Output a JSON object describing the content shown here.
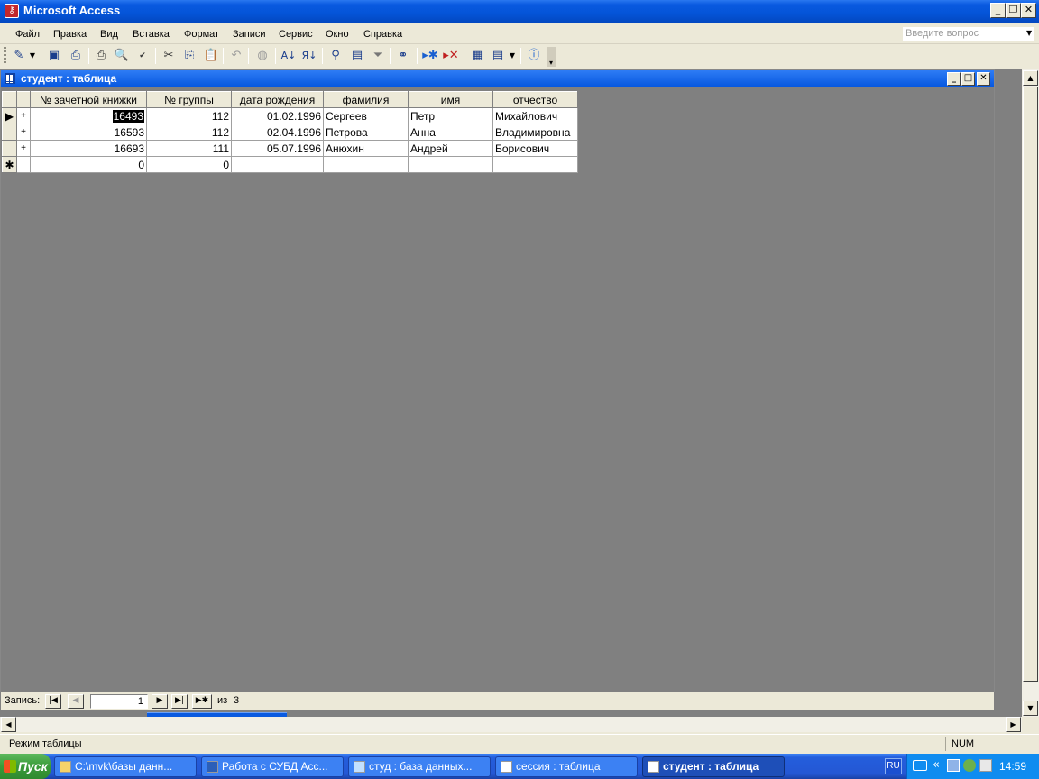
{
  "app": {
    "title": "Microsoft Access",
    "icon": "access-key-icon"
  },
  "menu": {
    "items": [
      "Файл",
      "Правка",
      "Вид",
      "Вставка",
      "Формат",
      "Записи",
      "Сервис",
      "Окно",
      "Справка"
    ],
    "help_placeholder": "Введите вопрос"
  },
  "toolbar": {
    "buttons": [
      "view-design-icon",
      "save-icon",
      "search-file-icon",
      "print-icon",
      "print-preview-icon",
      "spelling-icon",
      "cut-icon",
      "copy-icon",
      "paste-icon",
      "undo-icon",
      "insert-hyperlink-icon",
      "sort-ascending-icon",
      "sort-descending-icon",
      "filter-by-selection-icon",
      "filter-by-form-icon",
      "apply-filter-icon",
      "find-icon",
      "new-record-icon",
      "delete-record-icon",
      "database-window-icon",
      "new-object-icon",
      "help-icon"
    ]
  },
  "table_window": {
    "title": "студент : таблица",
    "columns": [
      "№ зачетной книжки",
      "№ группы",
      "дата рождения",
      "фамилия",
      "имя",
      "отчество"
    ],
    "rows": [
      {
        "selector": "▶",
        "expand": "+",
        "cells": [
          "16493",
          "112",
          "01.02.1996",
          "Сергеев",
          "Петр",
          "Михайлович"
        ]
      },
      {
        "selector": "",
        "expand": "+",
        "cells": [
          "16593",
          "112",
          "02.04.1996",
          "Петрова",
          "Анна",
          "Владимировна"
        ]
      },
      {
        "selector": "",
        "expand": "+",
        "cells": [
          "16693",
          "111",
          "05.07.1996",
          "Анюхин",
          "Андрей",
          "Борисович"
        ]
      }
    ],
    "new_row": {
      "selector": "✱",
      "cells": [
        "0",
        "0",
        "",
        "",
        "",
        ""
      ]
    }
  },
  "record_nav": {
    "label": "Запись:",
    "current": "1",
    "of_label": "из",
    "total": "3"
  },
  "status": {
    "mode": "Режим таблицы",
    "num": "NUM"
  },
  "taskbar": {
    "start": "Пуск",
    "tasks": [
      {
        "label": "C:\\mvk\\базы данн...",
        "icon": "folder-icon"
      },
      {
        "label": "Работа с СУБД Acc...",
        "icon": "word-doc-icon"
      },
      {
        "label": "студ : база данных...",
        "icon": "database-icon"
      },
      {
        "label": "сессия : таблица",
        "icon": "table-icon"
      },
      {
        "label": "студент : таблица",
        "icon": "table-icon"
      }
    ],
    "lang": "RU",
    "time": "14:59"
  }
}
